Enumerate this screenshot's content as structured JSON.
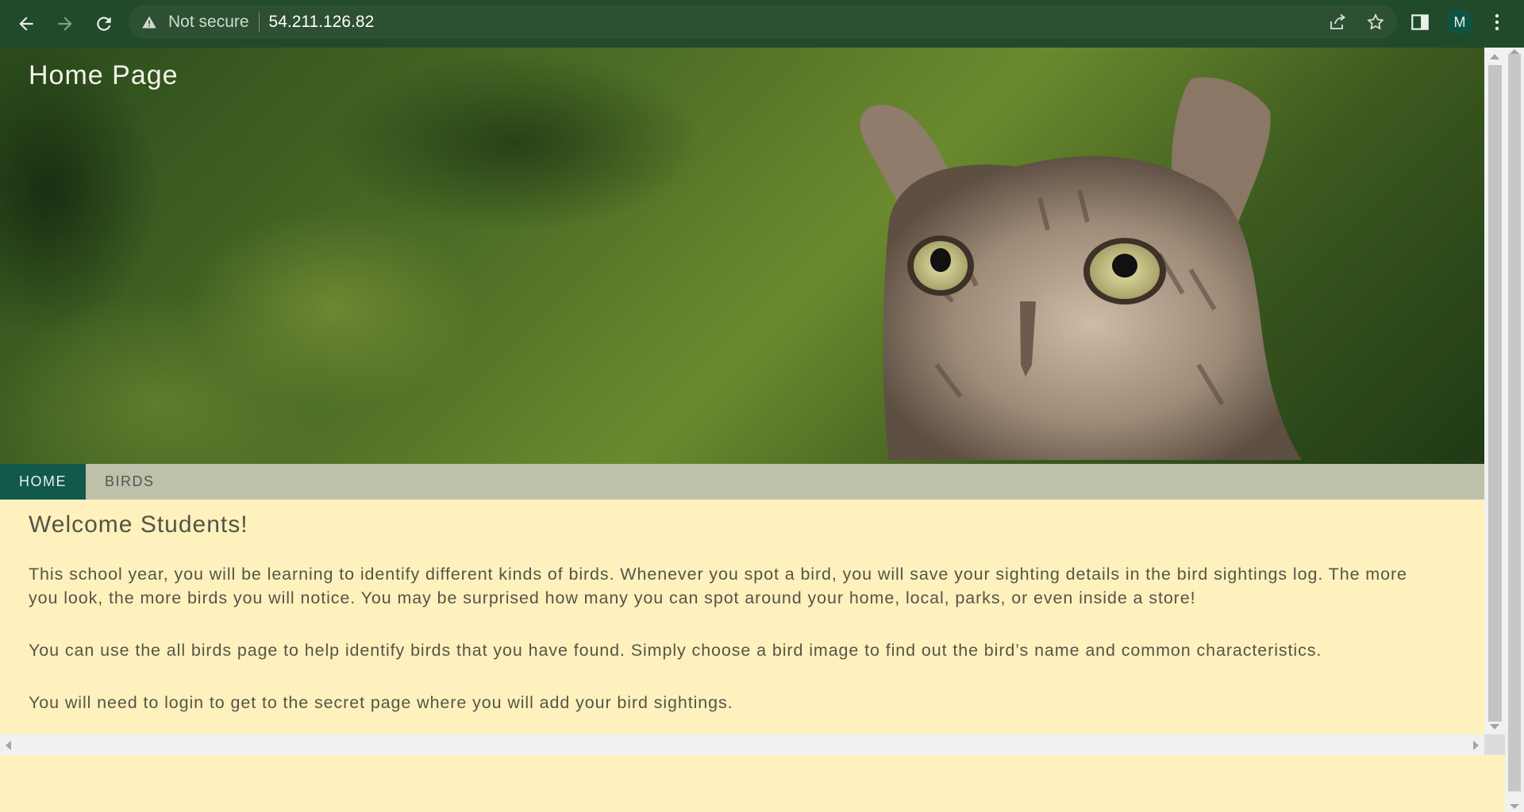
{
  "browser": {
    "security_label": "Not secure",
    "url": "54.211.126.82",
    "profile_initial": "M",
    "icons": [
      "back-arrow-icon",
      "forward-arrow-icon",
      "reload-icon",
      "warning-icon",
      "share-icon",
      "star-icon",
      "side-panel-icon",
      "more-vert-icon"
    ],
    "colors": {
      "toolbar": "#214a2a",
      "omnibox": "#2d4f32",
      "avatar": "#0f5442"
    }
  },
  "page": {
    "hero_title": "Home Page",
    "nav": [
      {
        "label": "HOME",
        "active": true
      },
      {
        "label": "BIRDS",
        "active": false
      }
    ],
    "heading": "Welcome Students!",
    "paragraphs": [
      "This school year, you will be learning to identify different kinds of birds. Whenever you spot a bird, you will save your sighting details in the bird sightings log. The more you look, the more birds you will notice. You may be surprised how many you can spot around your home, local, parks, or even inside a store!",
      "You can use the all birds page to help identify birds that you have found. Simply choose a bird image to find out the bird’s name and common characteristics.",
      "You will need to login to get to the secret page where you will add your bird sightings."
    ],
    "colors": {
      "background": "#fff1bd",
      "nav_bar": "#bfc0aa",
      "nav_active": "#12594a",
      "text": "#555548"
    }
  }
}
